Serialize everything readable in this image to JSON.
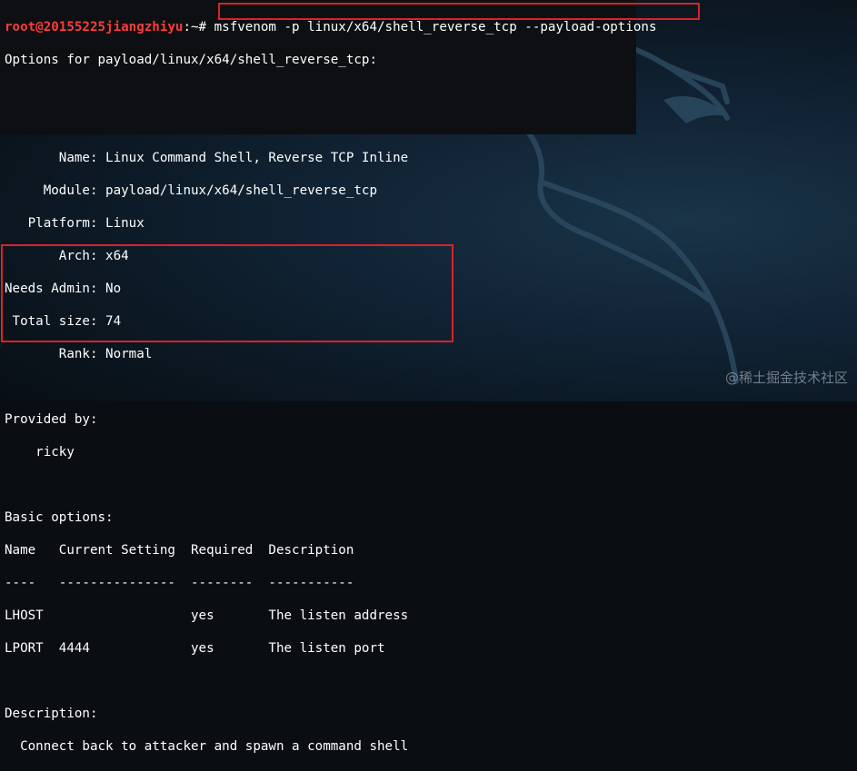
{
  "prompt": {
    "user_host": "root@20155225jiangzhiyu",
    "path": ":~#",
    "command": "msfvenom -p linux/x64/shell_reverse_tcp --payload-options"
  },
  "output": {
    "header": "Options for payload/linux/x64/shell_reverse_tcp:",
    "info": [
      "       Name: Linux Command Shell, Reverse TCP Inline",
      "     Module: payload/linux/x64/shell_reverse_tcp",
      "   Platform: Linux",
      "       Arch: x64",
      "Needs Admin: No",
      " Total size: 74",
      "       Rank: Normal"
    ],
    "provided_by_label": "Provided by:",
    "provided_by_value": "    ricky",
    "basic_options_label": "Basic options:",
    "options_table": {
      "header": "Name   Current Setting  Required  Description",
      "separator": "----   ---------------  --------  -----------",
      "rows": [
        "LHOST                   yes       The listen address",
        "LPORT  4444             yes       The listen port"
      ]
    },
    "description_label": "Description:",
    "description_text": "  Connect back to attacker and spawn a command shell"
  },
  "watermark": "@稀土掘金技术社区",
  "colors": {
    "prompt_user": "#ff3b3b",
    "highlight_border": "#d8232a",
    "text": "#ffffff"
  }
}
